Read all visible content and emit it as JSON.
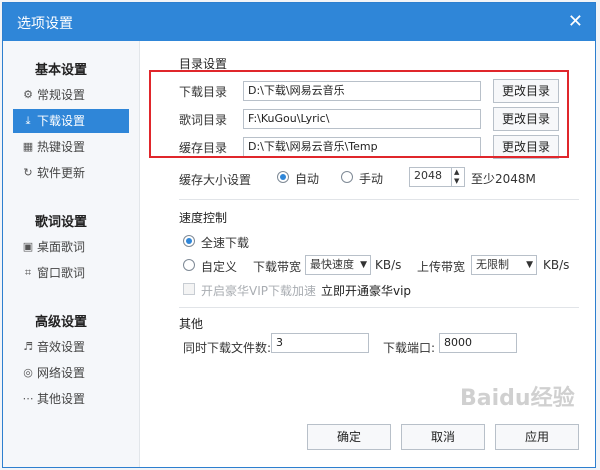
{
  "dialog": {
    "title": "选项设置"
  },
  "sidebar": {
    "groups": [
      {
        "title": "基本设置",
        "items": [
          {
            "label": "常规设置",
            "icon": "settings-icon"
          },
          {
            "label": "下载设置",
            "icon": "download-icon",
            "active": true
          },
          {
            "label": "热键设置",
            "icon": "keyboard-icon"
          },
          {
            "label": "软件更新",
            "icon": "update-icon"
          }
        ]
      },
      {
        "title": "歌词设置",
        "items": [
          {
            "label": "桌面歌词",
            "icon": "desktop-lyric-icon"
          },
          {
            "label": "窗口歌词",
            "icon": "window-lyric-icon"
          }
        ]
      },
      {
        "title": "高级设置",
        "items": [
          {
            "label": "音效设置",
            "icon": "equalizer-icon"
          },
          {
            "label": "网络设置",
            "icon": "network-icon"
          },
          {
            "label": "其他设置",
            "icon": "more-icon"
          }
        ]
      }
    ]
  },
  "directory": {
    "section_title": "目录设置",
    "rows": [
      {
        "label": "下载目录",
        "value": "D:\\下载\\网易云音乐",
        "button": "更改目录"
      },
      {
        "label": "歌词目录",
        "value": "F:\\KuGou\\Lyric\\",
        "button": "更改目录"
      },
      {
        "label": "缓存目录",
        "value": "D:\\下载\\网易云音乐\\Temp",
        "button": "更改目录"
      }
    ]
  },
  "cache": {
    "label": "缓存大小设置",
    "auto_label": "自动",
    "manual_label": "手动",
    "size_value": "2048",
    "min_text": "至少2048M",
    "selected": "auto"
  },
  "speed": {
    "section_title": "速度控制",
    "full_label": "全速下载",
    "custom_label": "自定义",
    "download_bw_label": "下载带宽",
    "download_bw_value": "最快速度",
    "download_unit": "KB/s",
    "upload_bw_label": "上传带宽",
    "upload_bw_value": "无限制",
    "upload_unit": "KB/s",
    "vip_label": "开启豪华VIP下载加速",
    "vip_link": "立即开通豪华vip",
    "selected": "full"
  },
  "other": {
    "section_title": "其他",
    "concurrent_label": "同时下载文件数:",
    "concurrent_value": "3",
    "port_label": "下载端口:",
    "port_value": "8000"
  },
  "footer": {
    "ok": "确定",
    "cancel": "取消",
    "apply": "应用"
  },
  "watermark": "Baidu经验",
  "colors": {
    "accent": "#2f86d8",
    "highlight_box": "#e0262b"
  }
}
